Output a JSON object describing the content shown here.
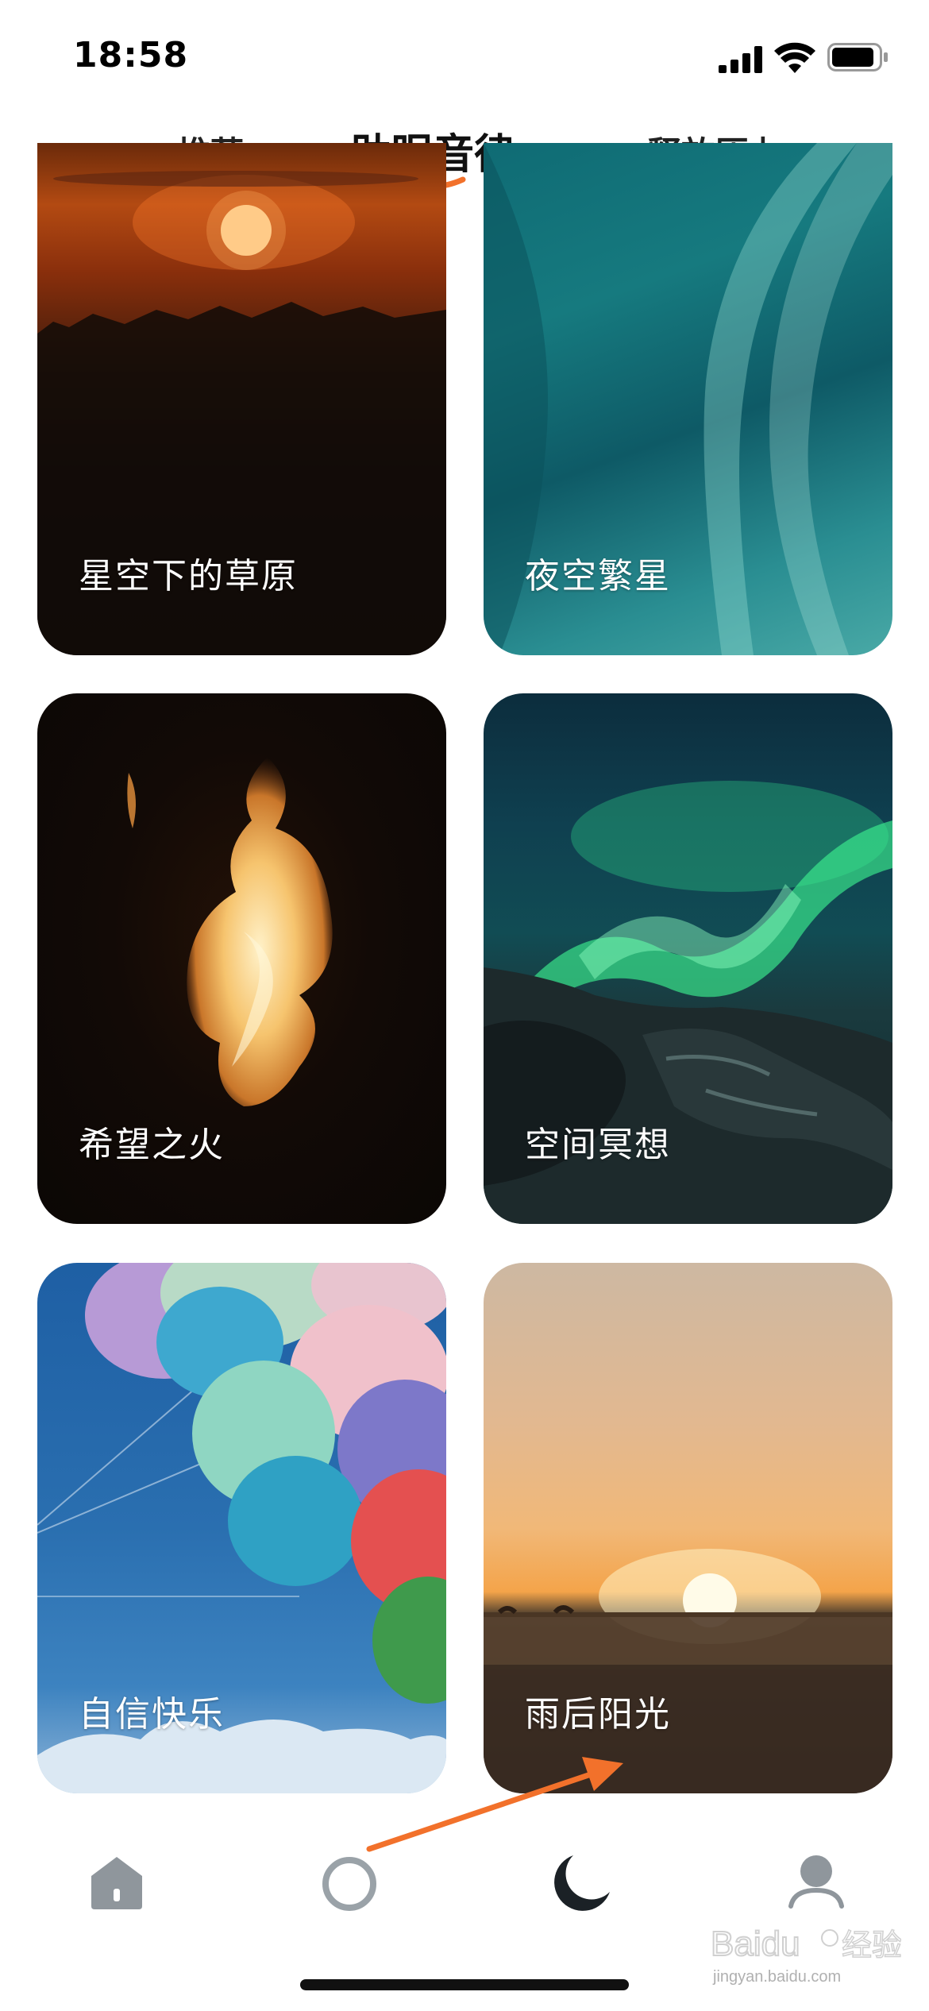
{
  "status_bar": {
    "time": "18:58"
  },
  "tabs": [
    {
      "label": "推荐",
      "active": false
    },
    {
      "label": "助眠音律",
      "active": true
    },
    {
      "label": "释放压力",
      "active": false
    }
  ],
  "accent_color": "#f2712b",
  "cards": [
    {
      "title": "星空下的草原",
      "image": "sunset-over-grassland"
    },
    {
      "title": "夜空繁星",
      "image": "aurora-teal-sky"
    },
    {
      "title": "希望之火",
      "image": "flame-on-black"
    },
    {
      "title": "空间冥想",
      "image": "green-aurora-over-rocks"
    },
    {
      "title": "自信快乐",
      "image": "colorful-balloons-blue-sky"
    },
    {
      "title": "雨后阳光",
      "image": "sunrise-over-field"
    }
  ],
  "bottom_nav": [
    {
      "icon": "home-icon",
      "active": false
    },
    {
      "icon": "circle-icon",
      "active": false
    },
    {
      "icon": "moon-icon",
      "active": true
    },
    {
      "icon": "profile-icon",
      "active": false
    }
  ],
  "watermark": {
    "text": "jingyan.baidu.com",
    "logo": "Baidu 经验"
  }
}
